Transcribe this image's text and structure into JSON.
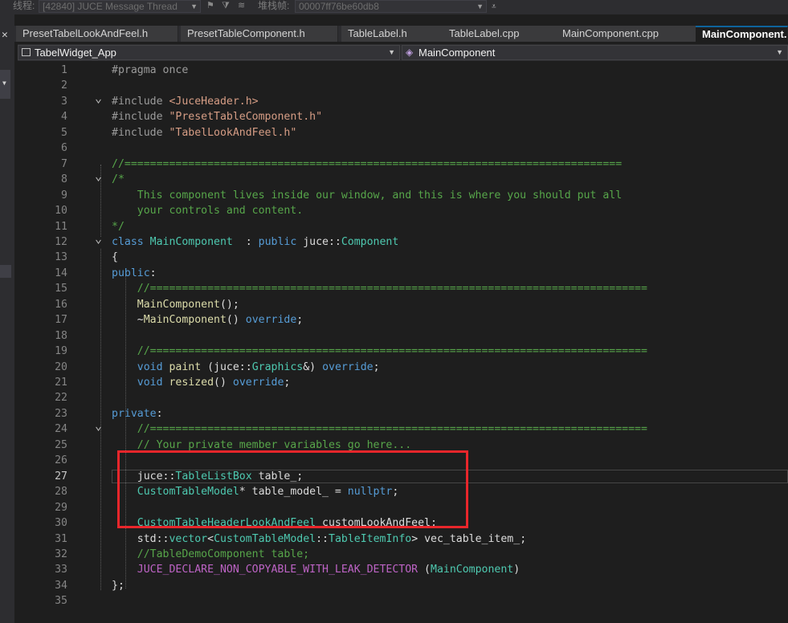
{
  "toolbar": {
    "thread_label": "线程:",
    "thread_value": "[42840] JUCE Message Thread",
    "stack_label": "堆栈帧:",
    "stack_value": "00007ff76be60db8"
  },
  "tabs": [
    {
      "label": "PresetTabelLookAndFeel.h",
      "active": false
    },
    {
      "label": "PresetTableComponent.h",
      "active": false
    },
    {
      "label": "TableLabel.h",
      "active": false
    },
    {
      "label": "TableLabel.cpp",
      "active": false
    },
    {
      "label": "MainComponent.cpp",
      "active": false
    },
    {
      "label": "MainComponent.h",
      "active": true
    }
  ],
  "navbar": {
    "project": "TabelWidget_App",
    "scope": "MainComponent"
  },
  "editor": {
    "current_line": 27,
    "lines": [
      {
        "n": "1",
        "fold": "",
        "indent": 0,
        "t": [
          [
            "pp",
            "#pragma once"
          ]
        ]
      },
      {
        "n": "2",
        "fold": "",
        "indent": 0,
        "t": []
      },
      {
        "n": "3",
        "fold": "v",
        "indent": 0,
        "t": [
          [
            "pp",
            "#include "
          ],
          [
            "str",
            "<JuceHeader.h>"
          ]
        ]
      },
      {
        "n": "4",
        "fold": "",
        "indent": 0,
        "t": [
          [
            "pp",
            "#include "
          ],
          [
            "str",
            "\"PresetTableComponent.h\""
          ]
        ]
      },
      {
        "n": "5",
        "fold": "",
        "indent": 0,
        "t": [
          [
            "pp",
            "#include "
          ],
          [
            "str",
            "\"TabelLookAndFeel.h\""
          ]
        ]
      },
      {
        "n": "6",
        "fold": "",
        "indent": 0,
        "t": []
      },
      {
        "n": "7",
        "fold": "",
        "indent": 0,
        "t": [
          [
            "cm",
            "//=============================================================================="
          ]
        ]
      },
      {
        "n": "8",
        "fold": "v",
        "indent": 0,
        "t": [
          [
            "cm",
            "/*"
          ]
        ]
      },
      {
        "n": "9",
        "fold": "",
        "indent": 0,
        "t": [
          [
            "cm",
            "    This component lives inside our window, and this is where you should put all"
          ]
        ]
      },
      {
        "n": "10",
        "fold": "",
        "indent": 0,
        "t": [
          [
            "cm",
            "    your controls and content."
          ]
        ]
      },
      {
        "n": "11",
        "fold": "",
        "indent": 0,
        "t": [
          [
            "cm",
            "*/"
          ]
        ]
      },
      {
        "n": "12",
        "fold": "v",
        "indent": 0,
        "t": [
          [
            "kw",
            "class "
          ],
          [
            "ty",
            "MainComponent"
          ],
          [
            "pl",
            "  : "
          ],
          [
            "kw",
            "public "
          ],
          [
            "pl",
            "juce::"
          ],
          [
            "ty",
            "Component"
          ]
        ]
      },
      {
        "n": "13",
        "fold": "",
        "indent": 0,
        "t": [
          [
            "pl",
            "{"
          ]
        ]
      },
      {
        "n": "14",
        "fold": "",
        "indent": 0,
        "t": [
          [
            "kw",
            "public"
          ],
          [
            "pl",
            ":"
          ]
        ]
      },
      {
        "n": "15",
        "fold": "",
        "indent": 0,
        "t": [
          [
            "cm",
            "    //=============================================================================="
          ]
        ]
      },
      {
        "n": "16",
        "fold": "",
        "indent": 0,
        "t": [
          [
            "pl",
            "    "
          ],
          [
            "fn",
            "MainComponent"
          ],
          [
            "pl",
            "();"
          ]
        ]
      },
      {
        "n": "17",
        "fold": "",
        "indent": 0,
        "t": [
          [
            "pl",
            "    ~"
          ],
          [
            "fn",
            "MainComponent"
          ],
          [
            "pl",
            "() "
          ],
          [
            "kw",
            "override"
          ],
          [
            "pl",
            ";"
          ]
        ]
      },
      {
        "n": "18",
        "fold": "",
        "indent": 0,
        "t": []
      },
      {
        "n": "19",
        "fold": "",
        "indent": 0,
        "t": [
          [
            "cm",
            "    //=============================================================================="
          ]
        ]
      },
      {
        "n": "20",
        "fold": "",
        "indent": 0,
        "t": [
          [
            "kw",
            "    void "
          ],
          [
            "fn",
            "paint"
          ],
          [
            "pl",
            " (juce::"
          ],
          [
            "ty",
            "Graphics"
          ],
          [
            "pl",
            "&) "
          ],
          [
            "kw",
            "override"
          ],
          [
            "pl",
            ";"
          ]
        ]
      },
      {
        "n": "21",
        "fold": "",
        "indent": 0,
        "t": [
          [
            "kw",
            "    void "
          ],
          [
            "fn",
            "resized"
          ],
          [
            "pl",
            "() "
          ],
          [
            "kw",
            "override"
          ],
          [
            "pl",
            ";"
          ]
        ]
      },
      {
        "n": "22",
        "fold": "",
        "indent": 0,
        "t": []
      },
      {
        "n": "23",
        "fold": "",
        "indent": 0,
        "t": [
          [
            "kw",
            "private"
          ],
          [
            "pl",
            ":"
          ]
        ]
      },
      {
        "n": "24",
        "fold": "v",
        "indent": 0,
        "t": [
          [
            "cm",
            "    //=============================================================================="
          ]
        ]
      },
      {
        "n": "25",
        "fold": "",
        "indent": 0,
        "t": [
          [
            "cm",
            "    // Your private member variables go here..."
          ]
        ]
      },
      {
        "n": "26",
        "fold": "",
        "indent": 0,
        "t": []
      },
      {
        "n": "27",
        "fold": "",
        "indent": 0,
        "t": [
          [
            "pl",
            "    juce::"
          ],
          [
            "ty",
            "TableListBox"
          ],
          [
            "pl",
            " table_;"
          ]
        ]
      },
      {
        "n": "28",
        "fold": "",
        "indent": 0,
        "t": [
          [
            "ty",
            "    CustomTableModel"
          ],
          [
            "pl",
            "* table_model_ = "
          ],
          [
            "kw",
            "nullptr"
          ],
          [
            "pl",
            ";"
          ]
        ]
      },
      {
        "n": "29",
        "fold": "",
        "indent": 0,
        "t": []
      },
      {
        "n": "30",
        "fold": "",
        "indent": 0,
        "t": [
          [
            "ty",
            "    CustomTableHeaderLookAndFeel"
          ],
          [
            "pl",
            " customLookAndFeel;"
          ]
        ]
      },
      {
        "n": "31",
        "fold": "",
        "indent": 0,
        "t": [
          [
            "pl",
            "    std::"
          ],
          [
            "ty",
            "vector"
          ],
          [
            "pl",
            "<"
          ],
          [
            "ty",
            "CustomTableModel"
          ],
          [
            "pl",
            "::"
          ],
          [
            "ty",
            "TableItemInfo"
          ],
          [
            "pl",
            "> vec_table_item_;"
          ]
        ]
      },
      {
        "n": "32",
        "fold": "",
        "indent": 0,
        "t": [
          [
            "cm",
            "    //TableDemoComponent table;"
          ]
        ]
      },
      {
        "n": "33",
        "fold": "",
        "indent": 0,
        "t": [
          [
            "mac",
            "    JUCE_DECLARE_NON_COPYABLE_WITH_LEAK_DETECTOR"
          ],
          [
            "pl",
            " ("
          ],
          [
            "ty",
            "MainComponent"
          ],
          [
            "pl",
            ")"
          ]
        ]
      },
      {
        "n": "34",
        "fold": "",
        "indent": 0,
        "t": [
          [
            "pl",
            "};"
          ]
        ]
      },
      {
        "n": "35",
        "fold": "",
        "indent": 0,
        "t": []
      }
    ]
  }
}
